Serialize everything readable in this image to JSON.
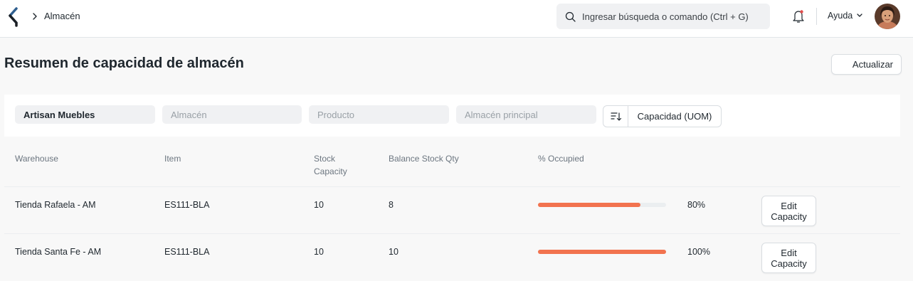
{
  "navbar": {
    "breadcrumb": "Almacén",
    "search_placeholder": "Ingresar búsqueda o comando (Ctrl + G)",
    "help_label": "Ayuda",
    "icons": [
      "app-logo-icon",
      "chevron-right-icon",
      "search-icon",
      "bell-icon",
      "chevron-down-icon"
    ]
  },
  "page": {
    "title": "Resumen de capacidad de almacén",
    "refresh_label": "Actualizar"
  },
  "filters": {
    "company_value": "Artisan Muebles",
    "warehouse_placeholder": "Almacén",
    "item_placeholder": "Producto",
    "parent_warehouse_placeholder": "Almacén principal",
    "sort_label": "Capacidad (UOM)"
  },
  "table": {
    "headers": [
      "Warehouse",
      "Item",
      "Stock\nCapacity",
      "Balance Stock Qty",
      "% Occupied"
    ],
    "edit_label": "Edit\nCapacity",
    "rows": [
      {
        "warehouse": "Tienda Rafaela - AM",
        "item": "ES111-BLA",
        "stock_capacity": "10",
        "balance_qty": "8",
        "occupied_pct": 80,
        "occupied_label": "80%"
      },
      {
        "warehouse": "Tienda Santa Fe - AM",
        "item": "ES111-BLA",
        "stock_capacity": "10",
        "balance_qty": "10",
        "occupied_pct": 100,
        "occupied_label": "100%"
      }
    ]
  },
  "colors": {
    "accent": "#f2734f",
    "track": "#ebeef0",
    "text": "#1f272e",
    "muted": "#6c7680"
  }
}
